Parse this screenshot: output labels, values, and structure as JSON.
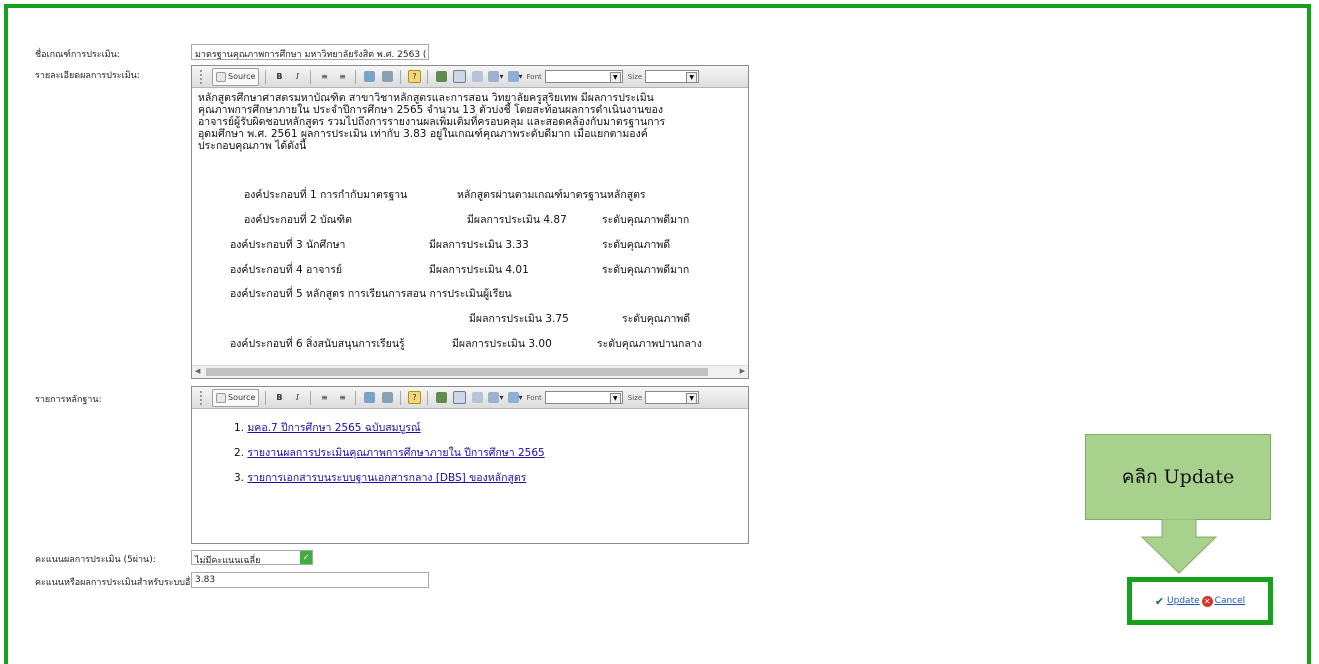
{
  "form": {
    "criteria_label": "ชื่อเกณฑ์การประเมิน:",
    "criteria_value": "มาตรฐานคุณภาพการศึกษา มหาวิทยาลัยรังสิต พ.ศ. 2563  (",
    "detail_label": "รายละเอียดผลการประเมิน:",
    "evidence_label": "รายการหลักฐาน:",
    "score_label": "คะแนนผลการประเมิน (5ผ่าน):",
    "score_value": "ไม่มีคะแนนเฉลี่ย",
    "other_label": "คะแนนหรือผลการประเมินสำหรับระบบอื่นๆ:",
    "other_value": "3.83"
  },
  "toolbar": {
    "source_label": "Source",
    "bold_label": "B",
    "italic_label": "I",
    "font_label": "Font",
    "size_label": "Size"
  },
  "detail": {
    "paragraph_lines": [
      "หลักสูตรศึกษาศาสตรมหาบัณฑิต  สาขาวิชาหลักสูตรและการสอน  วิทยาลัยครูสุริยเทพ  มีผลการประเมิน",
      "คุณภาพการศึกษาภายใน ประจำปีการศึกษา 2565 จำนวน 13 ตัวบ่งชี้  โดยสะท้อนผลการดำเนินงานของ",
      "อาจารย์ผู้รับผิดชอบหลักสูตร  รวมไปถึงการรายงานผลเพิ่มเติมที่ครอบคลุม  และสอดคล้องกับมาตรฐานการ",
      "อุดมศึกษา พ.ศ. 2561   ผลการประเมิน เท่ากับ 3.83 อยู่ในเกณฑ์คุณภาพระดับดีมาก เมื่อแยกตามองค์",
      "ประกอบคุณภาพ ได้ดังนี้"
    ],
    "items": [
      {
        "name": "องค์ประกอบที่ 1 การกำกับมาตรฐาน",
        "result": "หลักสูตรผ่านตามเกณฑ์มาตรฐานหลักสูตร",
        "level": ""
      },
      {
        "name": "องค์ประกอบที่ 2 บัณฑิต",
        "result": "มีผลการประเมิน   4.87",
        "level": "ระดับคุณภาพดีมาก"
      },
      {
        "name": "องค์ประกอบที่ 3 นักศึกษา",
        "result": "มีผลการประเมิน   3.33",
        "level": "ระดับคุณภาพดี"
      },
      {
        "name": "องค์ประกอบที่ 4 อาจารย์",
        "result": "มีผลการประเมิน   4.01",
        "level": "ระดับคุณภาพดีมาก"
      },
      {
        "name": "องค์ประกอบที่ 5 หลักสูตร การเรียนการสอน การประเมินผู้เรียน",
        "result": "",
        "level": ""
      },
      {
        "name": "",
        "result": "มีผลการประเมิน   3.75",
        "level": "ระดับคุณภาพดี"
      },
      {
        "name": "องค์ประกอบที่ 6 สิ่งสนับสนุนการเรียนรู้",
        "result": "มีผลการประเมิน   3.00",
        "level": "ระดับคุณภาพปานกลาง"
      }
    ]
  },
  "evidence": {
    "links": [
      {
        "num": "1.",
        "text": "มคอ.7 ปีการศึกษา 2565 ฉบับสมบูรณ์ "
      },
      {
        "num": "2.",
        "text": "รายงานผลการประเมินคุณภาพการศึกษาภายใน ปีการศึกษา 2565"
      },
      {
        "num": "3.",
        "text": "รายการเอกสารบนระบบฐานเอกสารกลาง [DBS] ของหลักสูตร"
      }
    ]
  },
  "callout": {
    "text": "คลิก Update"
  },
  "actions": {
    "update_label": "Update",
    "cancel_label": "Cancel"
  },
  "colors": {
    "frame": "#16a11c",
    "callout": "#a9d18e",
    "link": "#1a0dab"
  }
}
